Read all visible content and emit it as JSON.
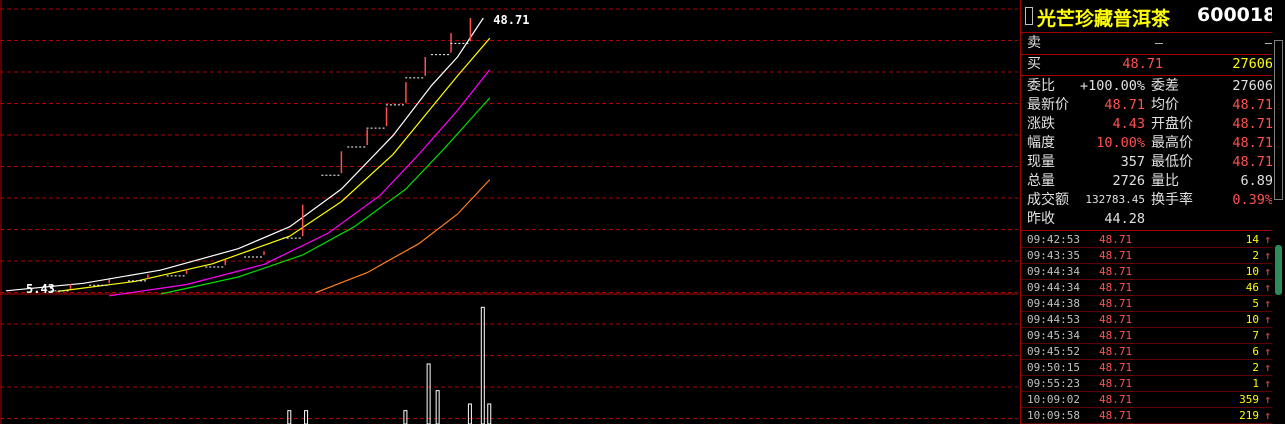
{
  "stock": {
    "name": "光芒珍藏普洱茶",
    "code": "600018"
  },
  "quote": {
    "sell_label": "卖",
    "sell_price": "—",
    "sell_vol": "—",
    "buy_label": "买",
    "buy_price": "48.71",
    "buy_vol": "27606",
    "rows": [
      {
        "l1": "委比",
        "v1": "+100.00%",
        "l2": "委差",
        "v2": "27606"
      },
      {
        "l1": "最新价",
        "v1": "48.71",
        "l2": "均价",
        "v2": "48.71"
      },
      {
        "l1": "涨跌",
        "v1": "4.43",
        "l2": "开盘价",
        "v2": "48.71"
      },
      {
        "l1": "幅度",
        "v1": "10.00%",
        "l2": "最高价",
        "v2": "48.71"
      },
      {
        "l1": "现量",
        "v1": "357",
        "l2": "最低价",
        "v2": "48.71"
      },
      {
        "l1": "总量",
        "v1": "2726",
        "l2": "量比",
        "v2": "6.89"
      },
      {
        "l1": "成交额",
        "v1": "132783.45",
        "l2": "换手率",
        "v2": "0.39%"
      },
      {
        "l1": "昨收",
        "v1": "44.28",
        "l2": "",
        "v2": ""
      }
    ]
  },
  "ticks": [
    {
      "time": "09:42:53",
      "price": "48.71",
      "vol": "14",
      "dir": "↑"
    },
    {
      "time": "09:43:35",
      "price": "48.71",
      "vol": "2",
      "dir": "↑"
    },
    {
      "time": "09:44:34",
      "price": "48.71",
      "vol": "10",
      "dir": "↑"
    },
    {
      "time": "09:44:34",
      "price": "48.71",
      "vol": "46",
      "dir": "↑"
    },
    {
      "time": "09:44:38",
      "price": "48.71",
      "vol": "5",
      "dir": "↑"
    },
    {
      "time": "09:44:53",
      "price": "48.71",
      "vol": "10",
      "dir": "↑"
    },
    {
      "time": "09:45:34",
      "price": "48.71",
      "vol": "7",
      "dir": "↑"
    },
    {
      "time": "09:45:52",
      "price": "48.71",
      "vol": "6",
      "dir": "↑"
    },
    {
      "time": "09:50:15",
      "price": "48.71",
      "vol": "2",
      "dir": "↑"
    },
    {
      "time": "09:55:23",
      "price": "48.71",
      "vol": "1",
      "dir": "↑"
    },
    {
      "time": "10:09:02",
      "price": "48.71",
      "vol": "359",
      "dir": "↑"
    },
    {
      "time": "10:09:58",
      "price": "48.71",
      "vol": "219",
      "dir": "↑"
    }
  ],
  "chart_data": {
    "type": "line",
    "title": "",
    "annotations": [
      {
        "text": "5.43",
        "x": 0,
        "y": 5.43
      },
      {
        "text": "48.71",
        "x": 37,
        "y": 48.71
      }
    ],
    "ylim": [
      0,
      52
    ],
    "xlim": [
      0,
      80
    ],
    "grid": true,
    "candles": [
      {
        "x": 5,
        "open": 5.6,
        "close": 6.4,
        "high": 6.4,
        "low": 5.6
      },
      {
        "x": 8,
        "open": 6.5,
        "close": 7.1,
        "high": 7.1,
        "low": 6.5
      },
      {
        "x": 11,
        "open": 7.2,
        "close": 7.9,
        "high": 7.9,
        "low": 7.2
      },
      {
        "x": 14,
        "open": 8.0,
        "close": 8.7,
        "high": 8.7,
        "low": 8.0
      },
      {
        "x": 17,
        "open": 9.4,
        "close": 10.3,
        "high": 10.3,
        "low": 9.4
      },
      {
        "x": 20,
        "open": 11.0,
        "close": 11.6,
        "high": 11.6,
        "low": 11.0
      },
      {
        "x": 23,
        "open": 14.0,
        "close": 19.0,
        "high": 19.0,
        "low": 14.0
      },
      {
        "x": 26,
        "open": 24.0,
        "close": 27.5,
        "high": 27.5,
        "low": 24.0
      },
      {
        "x": 28,
        "open": 28.5,
        "close": 31.0,
        "high": 31.0,
        "low": 28.5
      },
      {
        "x": 29.5,
        "open": 31.5,
        "close": 34.5,
        "high": 34.5,
        "low": 31.5
      },
      {
        "x": 31,
        "open": 35.2,
        "close": 38.5,
        "high": 38.5,
        "low": 35.2
      },
      {
        "x": 32.5,
        "open": 39.5,
        "close": 42.5,
        "high": 42.5,
        "low": 39.5
      },
      {
        "x": 34.5,
        "open": 43.2,
        "close": 46.3,
        "high": 46.3,
        "low": 43.2
      },
      {
        "x": 36,
        "open": 45.0,
        "close": 48.71,
        "high": 48.71,
        "low": 45.0
      }
    ],
    "series": [
      {
        "color": "#ffffff",
        "values": [
          [
            0,
            5.3
          ],
          [
            6,
            6.5
          ],
          [
            12,
            8.6
          ],
          [
            18,
            12.0
          ],
          [
            22,
            15.5
          ],
          [
            26,
            21.5
          ],
          [
            30,
            30.0
          ],
          [
            33,
            38.0
          ],
          [
            35,
            42.5
          ],
          [
            37,
            48.71
          ]
        ]
      },
      {
        "color": "#ffff00",
        "values": [
          [
            4,
            5.2
          ],
          [
            10,
            6.8
          ],
          [
            16,
            9.6
          ],
          [
            22,
            14.0
          ],
          [
            26,
            19.5
          ],
          [
            30,
            27.0
          ],
          [
            33,
            34.5
          ],
          [
            35,
            39.5
          ],
          [
            37.5,
            45.5
          ]
        ]
      },
      {
        "color": "#ff00ff",
        "values": [
          [
            8,
            4.5
          ],
          [
            14,
            6.3
          ],
          [
            20,
            9.5
          ],
          [
            25,
            14.5
          ],
          [
            29,
            20.5
          ],
          [
            32,
            27.0
          ],
          [
            35,
            34.0
          ],
          [
            37.5,
            40.5
          ]
        ]
      },
      {
        "color": "#00dd00",
        "values": [
          [
            12,
            4.8
          ],
          [
            18,
            7.5
          ],
          [
            23,
            11.0
          ],
          [
            27,
            15.5
          ],
          [
            31,
            21.5
          ],
          [
            34,
            28.0
          ],
          [
            37.5,
            36.0
          ]
        ]
      },
      {
        "color": "#ff8020",
        "values": [
          [
            24,
            5.0
          ],
          [
            28,
            8.2
          ],
          [
            32,
            12.8
          ],
          [
            35,
            17.5
          ],
          [
            37.5,
            23.0
          ]
        ]
      }
    ],
    "volume": [
      {
        "x": 22,
        "v": 4
      },
      {
        "x": 23.3,
        "v": 4
      },
      {
        "x": 31,
        "v": 4
      },
      {
        "x": 32.8,
        "v": 18
      },
      {
        "x": 33.5,
        "v": 10
      },
      {
        "x": 36,
        "v": 6
      },
      {
        "x": 37,
        "v": 35
      },
      {
        "x": 37.5,
        "v": 6
      }
    ]
  }
}
